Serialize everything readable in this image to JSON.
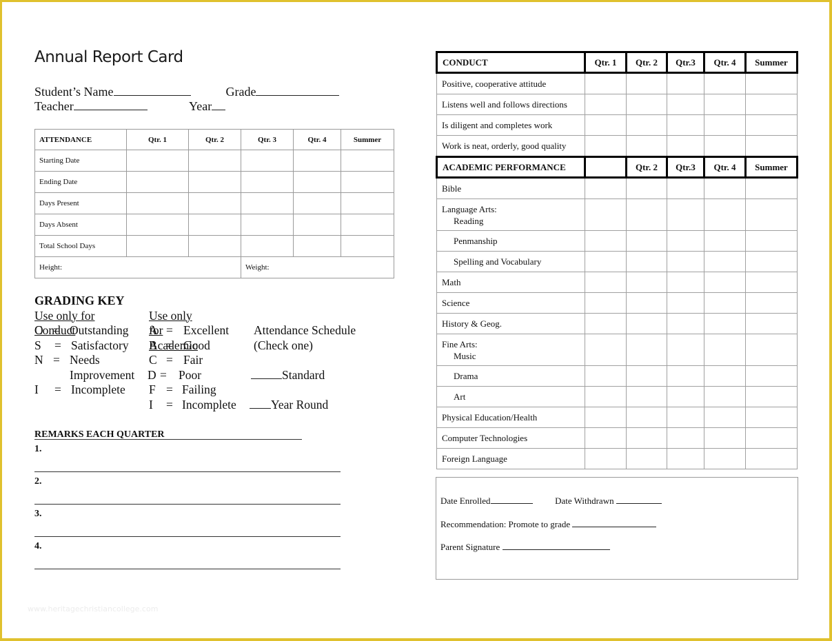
{
  "document": {
    "title": "Annual Report Card",
    "watermark": "www.heritagechristiancollege.com",
    "border_color": "#e0c12e"
  },
  "student_info": {
    "name_label": "Student’s Name",
    "grade_label": "Grade",
    "teacher_label": "Teacher",
    "year_label": "Year"
  },
  "attendance": {
    "headers": [
      "ATTENDANCE",
      "Qtr. 1",
      "Qtr. 2",
      "Qtr. 3",
      "Qtr. 4",
      "Summer"
    ],
    "rows": [
      "Starting Date",
      "Ending Date",
      "Days Present",
      "Days Absent",
      "Total School Days"
    ],
    "height_label": "Height:",
    "weight_label": "Weight:"
  },
  "grading_key": {
    "heading": "GRADING KEY",
    "conduct_heading": "Use only for Conduct",
    "academic_heading": "Use only for Academic",
    "conduct": [
      {
        "code": "O",
        "meaning": "Outstanding"
      },
      {
        "code": "S",
        "meaning": "Satisfactory"
      },
      {
        "code": "N",
        "meaning": "Needs"
      },
      {
        "code": "",
        "meaning": "Improvement"
      },
      {
        "code": "I",
        "meaning": "Incomplete"
      }
    ],
    "academic": [
      {
        "code": "A",
        "meaning": "Excellent"
      },
      {
        "code": "B",
        "meaning": "Good"
      },
      {
        "code": "C",
        "meaning": "Fair"
      },
      {
        "code": "D",
        "meaning": "Poor"
      },
      {
        "code": "F",
        "meaning": "Failing"
      },
      {
        "code": "I",
        "meaning": "Incomplete"
      }
    ],
    "schedule_heading": "Attendance Schedule",
    "schedule_note": "(Check one)",
    "schedule_options": [
      "Standard",
      "Year Round"
    ]
  },
  "remarks": {
    "heading": "REMARKS EACH QUARTER",
    "items": [
      "1.",
      "2.",
      "3.",
      "4."
    ]
  },
  "conduct": {
    "headers": [
      "CONDUCT",
      "Qtr. 1",
      "Qtr. 2",
      "Qtr.3",
      "Qtr. 4",
      "Summer"
    ],
    "rows": [
      "Positive, cooperative attitude",
      "Listens well and follows directions",
      "Is diligent and completes work",
      "Work is neat, orderly, good quality"
    ]
  },
  "academic": {
    "headers": [
      "ACADEMIC PERFORMANCE",
      "",
      "Qtr. 2",
      "Qtr.3",
      "Qtr. 4",
      "Summer"
    ],
    "rows": [
      {
        "label": "Bible",
        "sub": ""
      },
      {
        "label": "Language Arts:",
        "sub": "Reading"
      },
      {
        "label": "",
        "sub": "Penmanship"
      },
      {
        "label": "",
        "sub": "Spelling and Vocabulary"
      },
      {
        "label": "Math",
        "sub": ""
      },
      {
        "label": "Science",
        "sub": ""
      },
      {
        "label": "History & Geog.",
        "sub": ""
      },
      {
        "label": "Fine Arts:",
        "sub": "Music"
      },
      {
        "label": "",
        "sub": "Drama"
      },
      {
        "label": "",
        "sub": "Art"
      },
      {
        "label": "Physical Education/Health",
        "sub": ""
      },
      {
        "label": "Computer Technologies",
        "sub": ""
      },
      {
        "label": "Foreign Language",
        "sub": ""
      }
    ]
  },
  "footer": {
    "date_enrolled": "Date Enrolled",
    "date_withdrawn": "Date Withdrawn",
    "recommendation": "Recommendation:  Promote to grade",
    "parent_signature": "Parent Signature"
  }
}
